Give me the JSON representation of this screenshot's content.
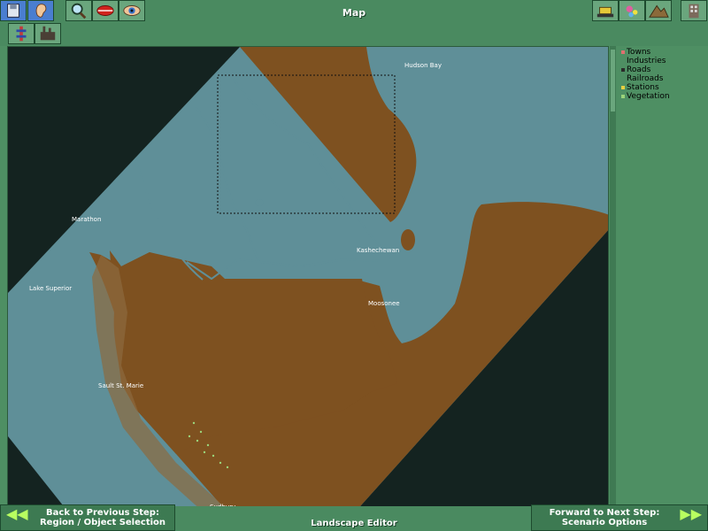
{
  "window": {
    "title": "Map"
  },
  "toolbar_left": [
    {
      "name": "save-icon"
    },
    {
      "name": "ear-icon"
    },
    {
      "name": "magnify-icon"
    },
    {
      "name": "lips-icon"
    },
    {
      "name": "eye-icon"
    }
  ],
  "toolbar_right": [
    {
      "name": "bulldozer-icon"
    },
    {
      "name": "flower-icon"
    },
    {
      "name": "terrain-icon"
    },
    {
      "name": "building-icon"
    }
  ],
  "toolbar_row2": [
    {
      "name": "tower-icon"
    },
    {
      "name": "factory-icon"
    }
  ],
  "legend": {
    "items": [
      {
        "label": "Towns",
        "color": "#e07070"
      },
      {
        "label": "Industries",
        "color": ""
      },
      {
        "label": "Roads",
        "color": "#2a2a2a"
      },
      {
        "label": "Railroads",
        "color": ""
      },
      {
        "label": "Stations",
        "color": "#e8d040"
      },
      {
        "label": "Vegetation",
        "color": "#9bd37a"
      }
    ]
  },
  "map": {
    "colors": {
      "water": "#5f8f98",
      "land": "#7e5120",
      "void": "#142320"
    },
    "towns": [
      "Hudson Bay",
      "Marathon",
      "Lake Superior",
      "Kashechewan",
      "Moosonee",
      "Sault St. Marie",
      "Sudbury"
    ]
  },
  "nav": {
    "back_line1": "Back to Previous Step:",
    "back_line2": "Region / Object Selection",
    "forward_line1": "Forward to Next Step:",
    "forward_line2": "Scenario Options",
    "back_arrows": "◀◀",
    "forward_arrows": "▶▶"
  },
  "editor_label": "Landscape Editor"
}
